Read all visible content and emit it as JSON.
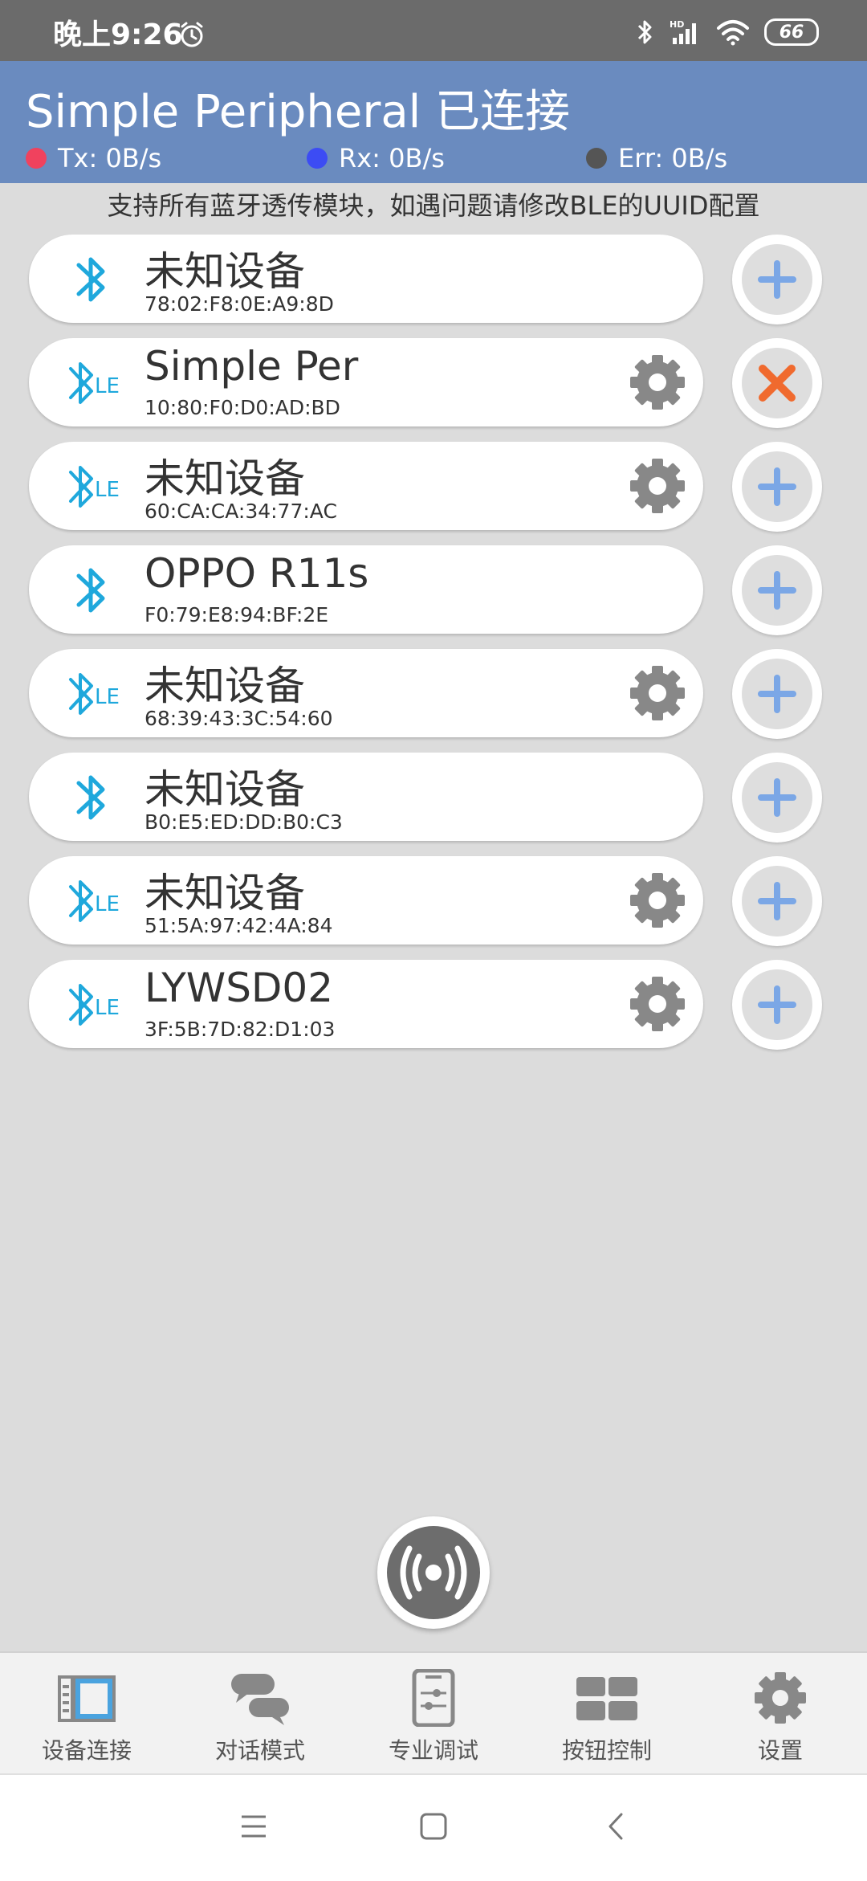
{
  "status_bar": {
    "time": "晚上9:26",
    "battery": "66"
  },
  "header": {
    "title": "Simple Peripheral 已连接",
    "tx": "Tx: 0B/s",
    "rx": "Rx: 0B/s",
    "err": "Err: 0B/s",
    "colors": {
      "tx": "#f0425e",
      "rx": "#3c4cf4",
      "err": "#555555",
      "bar": "#6a8bbf"
    }
  },
  "hint": "支持所有蓝牙透传模块，如遇问题请修改BLE的UUID配置",
  "devices": [
    {
      "name": "未知设备",
      "mac": "78:02:F8:0E:A9:8D",
      "type": "classic",
      "settings": false,
      "action": "connect"
    },
    {
      "name": "Simple Per",
      "mac": "10:80:F0:D0:AD:BD",
      "type": "le",
      "settings": true,
      "action": "disconnect"
    },
    {
      "name": "未知设备",
      "mac": "60:CA:CA:34:77:AC",
      "type": "le",
      "settings": true,
      "action": "connect"
    },
    {
      "name": "OPPO R11s",
      "mac": "F0:79:E8:94:BF:2E",
      "type": "classic",
      "settings": false,
      "action": "connect"
    },
    {
      "name": "未知设备",
      "mac": "68:39:43:3C:54:60",
      "type": "le",
      "settings": true,
      "action": "connect"
    },
    {
      "name": "未知设备",
      "mac": "B0:E5:ED:DD:B0:C3",
      "type": "classic",
      "settings": false,
      "action": "connect"
    },
    {
      "name": "未知设备",
      "mac": "51:5A:97:42:4A:84",
      "type": "le",
      "settings": true,
      "action": "connect"
    },
    {
      "name": "LYWSD02",
      "mac": "3F:5B:7D:82:D1:03",
      "type": "le",
      "settings": true,
      "action": "connect"
    }
  ],
  "nav": [
    {
      "label": "设备连接",
      "icon": "device-connect-icon"
    },
    {
      "label": "对话模式",
      "icon": "chat-icon"
    },
    {
      "label": "专业调试",
      "icon": "debug-icon"
    },
    {
      "label": "按钮控制",
      "icon": "button-grid-icon"
    },
    {
      "label": "设置",
      "icon": "gear-icon"
    }
  ]
}
